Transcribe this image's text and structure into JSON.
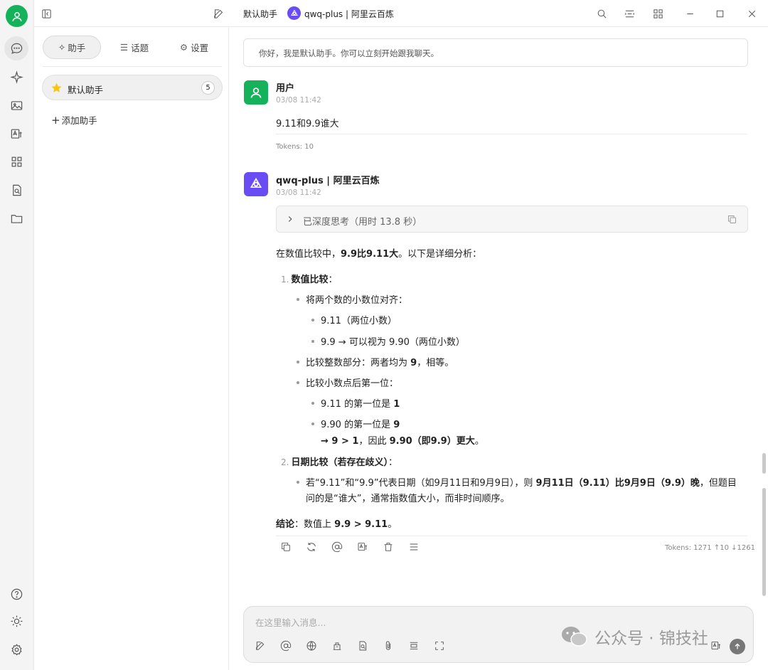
{
  "topbar": {
    "assistant_name": "默认助手",
    "model_label": "qwq-plus | 阿里云百炼"
  },
  "sidebar": {
    "tabs": [
      {
        "icon": "sparkle-icon",
        "label": "助手"
      },
      {
        "icon": "list-icon",
        "label": "话题"
      },
      {
        "icon": "gear-icon",
        "label": "设置"
      }
    ],
    "assistant": {
      "name": "默认助手",
      "count": "5"
    },
    "add_label": "添加助手"
  },
  "chat": {
    "greeting": "你好，我是默认助手。你可以立刻开始跟我聊天。",
    "user": {
      "name": "用户",
      "time": "03/08 11:42",
      "text": "9.11和9.9谁大",
      "tokens": "Tokens: 10"
    },
    "assistant": {
      "name": "qwq-plus | 阿里云百炼",
      "time": "03/08 11:42",
      "thinking": "已深度思考（用时 13.8 秒）",
      "intro_a": "在数值比较中，",
      "intro_b": "9.9比9.11大",
      "intro_c": "。以下是详细分析：",
      "s1_num": "1.",
      "s1_title": "数值比较",
      "s1_colon": "：",
      "b1": "将两个数的小数位对齐：",
      "b1a": "9.11（两位小数）",
      "b1b": "9.9 → 可以视为 9.90（两位小数）",
      "b2a": "比较整数部分：两者均为 ",
      "b2b": "9",
      "b2c": "，相等。",
      "b3": "比较小数点后第一位：",
      "b3a_a": "9.11 的第一位是 ",
      "b3a_b": "1",
      "b3b_a": "9.90 的第一位是 ",
      "b3b_b": "9",
      "b3c_a": "→ ",
      "b3c_b": "9 > 1",
      "b3c_c": "，因此 ",
      "b3c_d": "9.90（即9.9）更大",
      "b3c_e": "。",
      "s2_num": "2.",
      "s2_title": "日期比较（若存在歧义）",
      "s2_colon": "：",
      "d1_a": "若“9.11”和“9.9”代表日期（如9月11日和9月9日），则 ",
      "d1_b": "9月11日（9.11）比9月9日（9.9）晚",
      "d1_c": "，但题目",
      "d1_d": "问的是“谁大”，通常指数值大小，而非时间顺序。",
      "concl_a": "结论",
      "concl_b": "：数值上 ",
      "concl_c": "9.9 > 9.11",
      "concl_d": "。",
      "tokens": "Tokens: 1271 ↑10 ↓1261"
    }
  },
  "input": {
    "placeholder": "在这里输入消息..."
  },
  "watermark": "公众号 · 锦技社",
  "colors": {
    "brand_green": "#15b15b",
    "model_purple": "#6a4cf5"
  }
}
